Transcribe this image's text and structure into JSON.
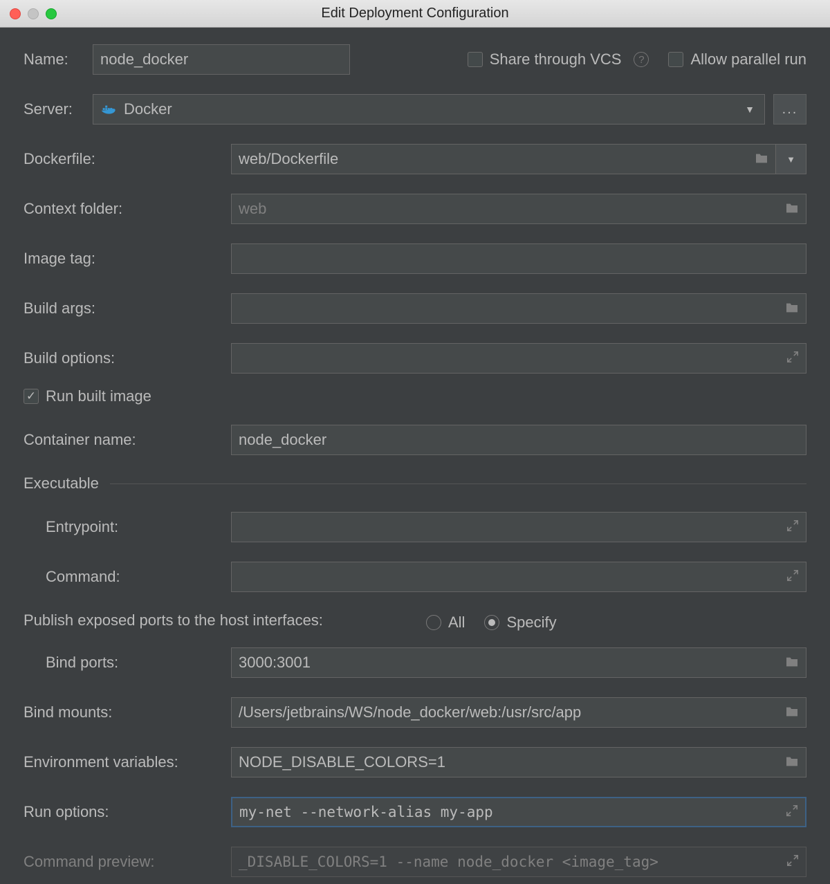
{
  "window": {
    "title": "Edit Deployment Configuration"
  },
  "top": {
    "name_label": "Name:",
    "name_value": "node_docker",
    "share_label": "Share through VCS",
    "allow_parallel_label": "Allow parallel run"
  },
  "server": {
    "label": "Server:",
    "value": "Docker",
    "more": "..."
  },
  "fields": {
    "dockerfile_label": "Dockerfile:",
    "dockerfile_value": "web/Dockerfile",
    "context_label": "Context folder:",
    "context_placeholder": "web",
    "imagetag_label": "Image tag:",
    "imagetag_value": "",
    "buildargs_label": "Build args:",
    "buildargs_value": "",
    "buildopts_label": "Build options:",
    "buildopts_value": "",
    "run_built_label": "Run built image",
    "container_label": "Container name:",
    "container_value": "node_docker"
  },
  "exec": {
    "section": "Executable",
    "entry_label": "Entrypoint:",
    "entry_value": "",
    "cmd_label": "Command:",
    "cmd_value": ""
  },
  "ports": {
    "publish_label": "Publish exposed ports to the host interfaces:",
    "all_label": "All",
    "specify_label": "Specify",
    "bind_label": "Bind ports:",
    "bind_value": "3000:3001"
  },
  "mounts": {
    "label": "Bind mounts:",
    "value": "/Users/jetbrains/WS/node_docker/web:/usr/src/app"
  },
  "env": {
    "label": "Environment variables:",
    "value": "NODE_DISABLE_COLORS=1"
  },
  "runopts": {
    "label": "Run options:",
    "value": "my-net --network-alias my-app"
  },
  "preview": {
    "label": "Command preview:",
    "value": "_DISABLE_COLORS=1 --name node_docker <image_tag>"
  }
}
